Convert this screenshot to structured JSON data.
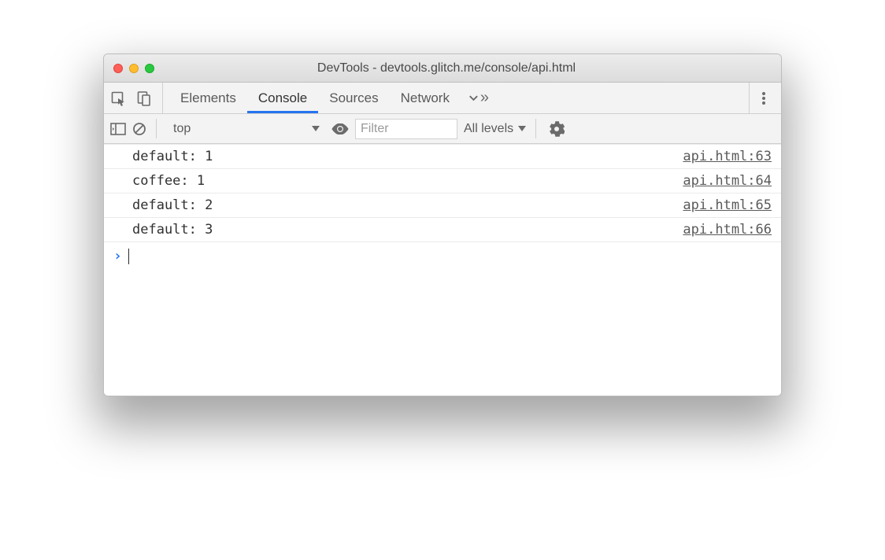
{
  "window": {
    "title": "DevTools - devtools.glitch.me/console/api.html"
  },
  "tabs": {
    "items": [
      "Elements",
      "Console",
      "Sources",
      "Network"
    ],
    "active": "Console"
  },
  "filterbar": {
    "context": "top",
    "filter_placeholder": "Filter",
    "levels_label": "All levels"
  },
  "console": {
    "rows": [
      {
        "msg": "default: 1",
        "src": "api.html:63"
      },
      {
        "msg": "coffee: 1",
        "src": "api.html:64"
      },
      {
        "msg": "default: 2",
        "src": "api.html:65"
      },
      {
        "msg": "default: 3",
        "src": "api.html:66"
      }
    ]
  }
}
